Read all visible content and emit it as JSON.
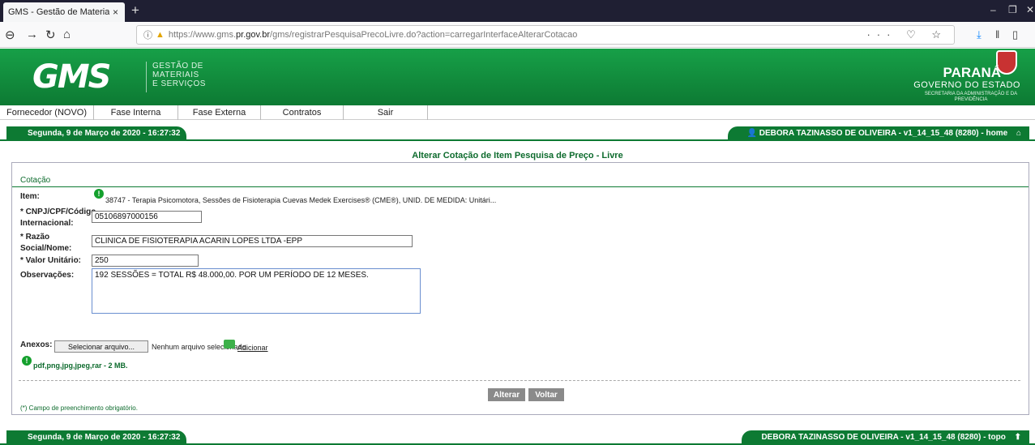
{
  "browser": {
    "tab_title": "GMS - Gestão de Materiais e Serviço",
    "tab_close": "×",
    "new_tab": "+",
    "url_prefix": "https://www.gms.",
    "url_domain": "pr.gov.br",
    "url_rest": "/gms/registrarPesquisaPrecoLivre.do?action=carregarInterfaceAlterarCotacao",
    "page_actions": "··· ♡ ☆"
  },
  "header": {
    "logo": "GMS",
    "subtitle_lines": [
      "GESTÃO DE",
      "MATERIAIS",
      "E SERVIÇOS"
    ],
    "state_name": "PARANÁ",
    "gov": "GOVERNO DO ESTADO",
    "secretaria": "SECRETARIA DA ADMINISTRAÇÃO E DA PREVIDÊNCIA"
  },
  "menu": [
    "Fornecedor (NOVO)",
    "Fase Interna",
    "Fase Externa",
    "Contratos",
    "Sair"
  ],
  "topbar": {
    "date": "Segunda, 9 de Março de 2020 - 16:27:32",
    "user": "DEBORA TAZINASSO DE OLIVEIRA - v1_14_15_48 (8280)",
    "home_link": "- home"
  },
  "page_title": "Alterar Cotação de Item Pesquisa de Preço - Livre",
  "form": {
    "section": "Cotação",
    "item_label": "Item:",
    "item_value": "38747 - Terapia Psicomotora, Sessões de Fisioterapia Cuevas Medek Exercises® (CME®), UNID. DE MEDIDA: Unitári...",
    "cnpj_label_1": "* CNPJ/CPF/Código",
    "cnpj_label_2": "Internacional:",
    "cnpj_value": "05106897000156",
    "razao_label_1": "* Razão",
    "razao_label_2": "Social/Nome:",
    "razao_value": "CLINICA DE FISIOTERAPIA ACARIN LOPES LTDA -EPP",
    "valor_label": "* Valor Unitário:",
    "valor_value": "250",
    "obs_label": "Observações:",
    "obs_value": "192 SESSÕES = TOTAL R$ 48.000,00. POR UM PERÍODO DE 12 MESES.",
    "anexos_label": "Anexos:",
    "file_button": "Selecionar arquivo...",
    "file_status": "Nenhum arquivo selecionado.",
    "add_link": "Adicionar",
    "file_types": "pdf,png,jpg,jpeg,rar - 2 MB.",
    "btn_alterar": "Alterar",
    "btn_voltar": "Voltar",
    "required_note": "(*) Campo de preenchimento obrigatório."
  },
  "bottombar": {
    "date": "Segunda, 9 de Março de 2020 - 16:27:32",
    "user": "DEBORA TAZINASSO DE OLIVEIRA - v1_14_15_48 (8280)",
    "topo_link": "- topo"
  },
  "colors": {
    "brand_green": "#0d7a33",
    "title_green": "#0d6b2d",
    "button_gray": "#8a8a8a"
  }
}
